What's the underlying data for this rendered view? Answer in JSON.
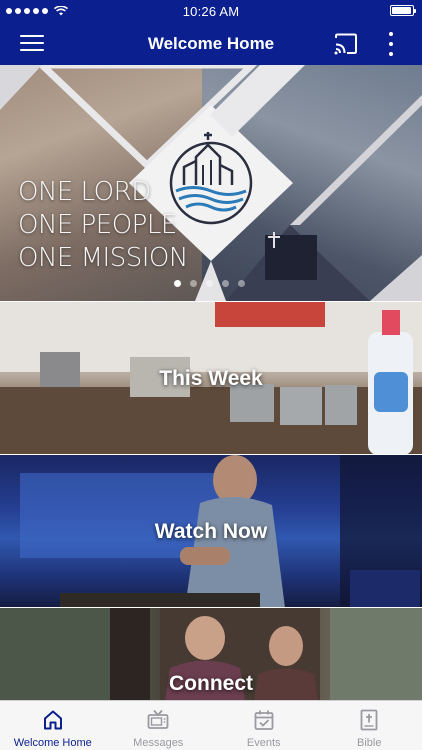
{
  "status_bar": {
    "time": "10:26 AM",
    "battery_level": 0.95,
    "signal_bars": 5
  },
  "app_bar": {
    "title": "Welcome Home",
    "menu_icon": "hamburger-menu-icon",
    "cast_icon": "cast-icon",
    "more_icon": "more-vertical-icon"
  },
  "hero": {
    "lines": [
      "ONE LORD",
      "ONE PEOPLE",
      "ONE MISSION"
    ],
    "logo_icon": "church-logo-icon",
    "carousel": {
      "count": 5,
      "active_index": 0
    }
  },
  "tiles": [
    {
      "id": "this-week",
      "label": "This Week"
    },
    {
      "id": "watch-now",
      "label": "Watch Now"
    },
    {
      "id": "connect",
      "label": "Connect"
    }
  ],
  "tab_bar": {
    "items": [
      {
        "id": "home",
        "label": "Welcome Home",
        "icon": "home-icon",
        "active": true
      },
      {
        "id": "messages",
        "label": "Messages",
        "icon": "tv-icon",
        "active": false
      },
      {
        "id": "events",
        "label": "Events",
        "icon": "calendar-check-icon",
        "active": false
      },
      {
        "id": "bible",
        "label": "Bible",
        "icon": "bible-icon",
        "active": false
      }
    ]
  },
  "colors": {
    "brand": "#0b1f8e",
    "tab_inactive": "#9a9aa0",
    "tab_bar_bg": "#f6f6f7"
  }
}
